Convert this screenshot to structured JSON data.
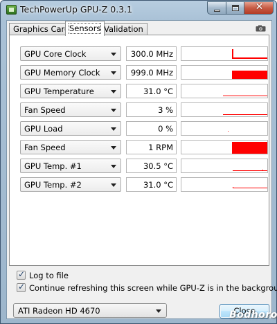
{
  "window": {
    "title": "TechPowerUp GPU-Z 0.3.1"
  },
  "tabs": [
    {
      "label": "Graphics Card",
      "active": false
    },
    {
      "label": "Sensors",
      "active": true
    },
    {
      "label": "Validation",
      "active": false
    }
  ],
  "toolbar": {
    "screenshot_icon": "camera-icon"
  },
  "sensors": [
    {
      "name": "GPU Core Clock",
      "value": "300.0 MHz",
      "graph": "spike-line"
    },
    {
      "name": "GPU Memory Clock",
      "value": "999.0 MHz",
      "graph": "solid-bar"
    },
    {
      "name": "GPU Temperature",
      "value": "31.0 °C",
      "graph": "low-line"
    },
    {
      "name": "Fan Speed",
      "value": "3 %",
      "graph": "low-line"
    },
    {
      "name": "GPU Load",
      "value": "0 %",
      "graph": "dot"
    },
    {
      "name": "Fan Speed",
      "value": "1 RPM",
      "graph": "solid-bar"
    },
    {
      "name": "GPU Temp. #1",
      "value": "30.5 °C",
      "graph": "low-line"
    },
    {
      "name": "GPU Temp. #2",
      "value": "31.0 °C",
      "graph": "low-line"
    }
  ],
  "options": {
    "log_to_file": {
      "label": "Log to file",
      "checked": true
    },
    "continue_refresh": {
      "label": "Continue refreshing this screen while GPU-Z is in the background",
      "checked": true
    }
  },
  "footer": {
    "selected_card": "ATI Radeon HD 4670",
    "close_label": "Close",
    "watermark": "Bodhoro"
  },
  "colors": {
    "graph_red": "#ff0000",
    "accent": "#3c7fb1"
  }
}
